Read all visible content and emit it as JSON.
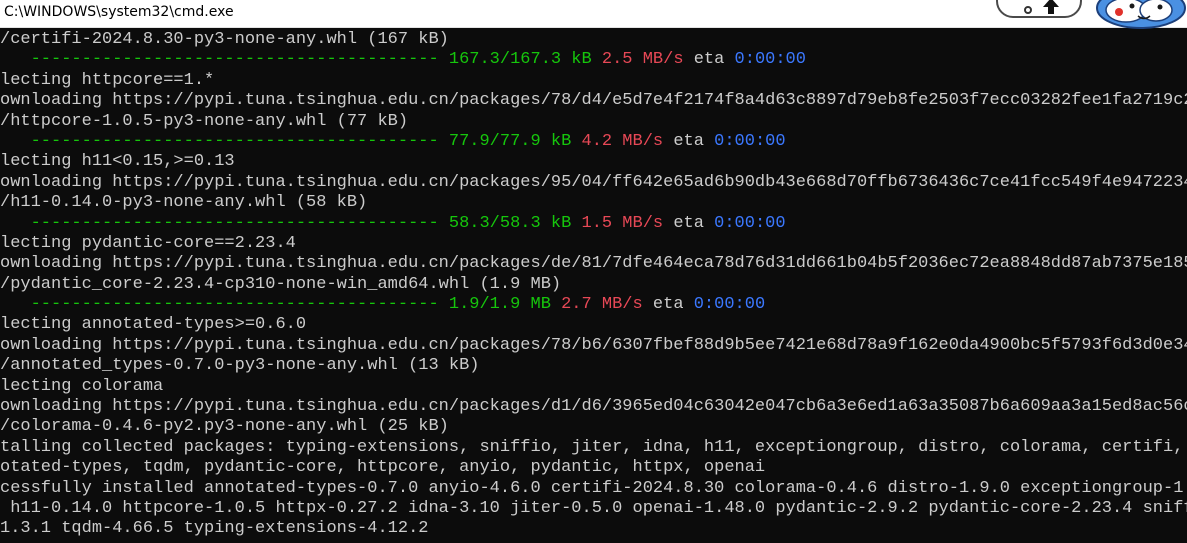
{
  "window": {
    "title": "C:\\WINDOWS\\system32\\cmd.exe"
  },
  "colors": {
    "background": "#0c0c0c",
    "text": "#cccccc",
    "progress": "#16c60c",
    "rate": "#e74856",
    "eta": "#3b78ff"
  },
  "icons": {
    "overlay_arrow": "up-arrow-icon",
    "mascot": "cartoon-mascot-icon"
  },
  "console": {
    "lines": [
      {
        "text": "/certifi-2024.8.30-py3-none-any.whl (167 kB)"
      },
      {
        "bar": "   ---------------------------------------- ",
        "progress": "167.3/167.3 kB",
        "rate": "2.5 MB/s",
        "eta_label": "eta",
        "eta": "0:00:00"
      },
      {
        "text": "lecting httpcore==1.*"
      },
      {
        "text": "ownloading https://pypi.tuna.tsinghua.edu.cn/packages/78/d4/e5d7e4f2174f8a4d63c8897d79eb8fe2503f7ecc03282fee1fa2719c2"
      },
      {
        "text": "/httpcore-1.0.5-py3-none-any.whl (77 kB)"
      },
      {
        "bar": "   ---------------------------------------- ",
        "progress": "77.9/77.9 kB",
        "rate": "4.2 MB/s",
        "eta_label": "eta",
        "eta": "0:00:00"
      },
      {
        "text": "lecting h11<0.15,>=0.13"
      },
      {
        "text": "ownloading https://pypi.tuna.tsinghua.edu.cn/packages/95/04/ff642e65ad6b90db43e668d70ffb6736436c7ce41fcc549f4e9472234"
      },
      {
        "text": "/h11-0.14.0-py3-none-any.whl (58 kB)"
      },
      {
        "bar": "   ---------------------------------------- ",
        "progress": "58.3/58.3 kB",
        "rate": "1.5 MB/s",
        "eta_label": "eta",
        "eta": "0:00:00"
      },
      {
        "text": "lecting pydantic-core==2.23.4"
      },
      {
        "text": "ownloading https://pypi.tuna.tsinghua.edu.cn/packages/de/81/7dfe464eca78d76d31dd661b04b5f2036ec72ea8848dd87ab7375e185"
      },
      {
        "text": "/pydantic_core-2.23.4-cp310-none-win_amd64.whl (1.9 MB)"
      },
      {
        "bar": "   ---------------------------------------- ",
        "progress": "1.9/1.9 MB",
        "rate": "2.7 MB/s",
        "eta_label": "eta",
        "eta": "0:00:00"
      },
      {
        "text": "lecting annotated-types>=0.6.0"
      },
      {
        "text": "ownloading https://pypi.tuna.tsinghua.edu.cn/packages/78/b6/6307fbef88d9b5ee7421e68d78a9f162e0da4900bc5f5793f6d3d0e34"
      },
      {
        "text": "/annotated_types-0.7.0-py3-none-any.whl (13 kB)"
      },
      {
        "text": "lecting colorama"
      },
      {
        "text": "ownloading https://pypi.tuna.tsinghua.edu.cn/packages/d1/d6/3965ed04c63042e047cb6a3e6ed1a63a35087b6a609aa3a15ed8ac56c"
      },
      {
        "text": "/colorama-0.4.6-py2.py3-none-any.whl (25 kB)"
      },
      {
        "text": "talling collected packages: typing-extensions, sniffio, jiter, idna, h11, exceptiongroup, distro, colorama, certifi,"
      },
      {
        "text": "otated-types, tqdm, pydantic-core, httpcore, anyio, pydantic, httpx, openai"
      },
      {
        "text": "cessfully installed annotated-types-0.7.0 anyio-4.6.0 certifi-2024.8.30 colorama-0.4.6 distro-1.9.0 exceptiongroup-1."
      },
      {
        "text": " h11-0.14.0 httpcore-1.0.5 httpx-0.27.2 idna-3.10 jiter-0.5.0 openai-1.48.0 pydantic-2.9.2 pydantic-core-2.23.4 sniff"
      },
      {
        "text": "1.3.1 tqdm-4.66.5 typing-extensions-4.12.2"
      }
    ]
  }
}
